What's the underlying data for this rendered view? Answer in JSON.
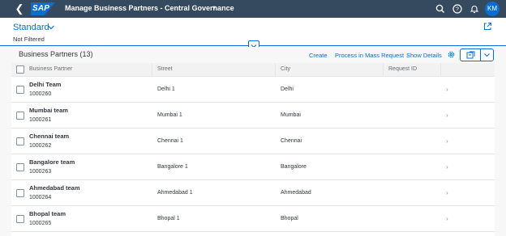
{
  "shell": {
    "app_title": "Manage Business Partners - Central Governance",
    "logo_text": "SAP",
    "user_initials": "KM",
    "brand_color": "#354a5f",
    "accent_color": "#0a6ed1"
  },
  "header": {
    "variant": "Standard",
    "filter_status": "Not Filtered"
  },
  "toolbar": {
    "title": "Business Partners (13)",
    "create_label": "Create",
    "mass_request_label": "Process in Mass Request",
    "show_details_label": "Show Details"
  },
  "table": {
    "columns": [
      "Business Partner",
      "Street",
      "City",
      "Request ID"
    ],
    "rows": [
      {
        "name": "Delhi Team",
        "id": "1000260",
        "street": "Delhi 1",
        "city": "Delhi",
        "request_id": ""
      },
      {
        "name": "Mumbai team",
        "id": "1000261",
        "street": "Mumbai 1",
        "city": "Mumbai",
        "request_id": ""
      },
      {
        "name": "Chennai team",
        "id": "1000262",
        "street": "Chennai 1",
        "city": "Chennai",
        "request_id": ""
      },
      {
        "name": "Bangalore team",
        "id": "1000263",
        "street": "Bangalore 1",
        "city": "Bangalore",
        "request_id": ""
      },
      {
        "name": "Ahmedabad team",
        "id": "1000264",
        "street": "Ahmedabad 1",
        "city": "Ahmedabad",
        "request_id": ""
      },
      {
        "name": "Bhopal team",
        "id": "1000265",
        "street": "Bhopal 1",
        "city": "Bhopal",
        "request_id": ""
      }
    ]
  }
}
